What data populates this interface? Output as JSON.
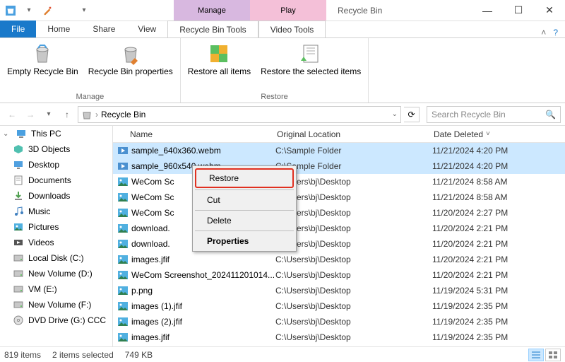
{
  "title": "Recycle Bin",
  "contextual_tabs": [
    {
      "group": "Manage",
      "tab": "Recycle Bin Tools"
    },
    {
      "group": "Play",
      "tab": "Video Tools"
    }
  ],
  "tabs": {
    "file": "File",
    "home": "Home",
    "share": "Share",
    "view": "View"
  },
  "ribbon": {
    "manage_group": "Manage",
    "restore_group": "Restore",
    "empty": "Empty Recycle Bin",
    "props": "Recycle Bin properties",
    "restore_all": "Restore all items",
    "restore_sel": "Restore the selected items"
  },
  "address": {
    "location": "Recycle Bin"
  },
  "search": {
    "placeholder": "Search Recycle Bin"
  },
  "nav_pane": [
    {
      "label": "This PC",
      "icon": "pc"
    },
    {
      "label": "3D Objects",
      "icon": "3d"
    },
    {
      "label": "Desktop",
      "icon": "desktop"
    },
    {
      "label": "Documents",
      "icon": "docs"
    },
    {
      "label": "Downloads",
      "icon": "downloads"
    },
    {
      "label": "Music",
      "icon": "music"
    },
    {
      "label": "Pictures",
      "icon": "pictures"
    },
    {
      "label": "Videos",
      "icon": "videos"
    },
    {
      "label": "Local Disk (C:)",
      "icon": "disk"
    },
    {
      "label": "New Volume (D:)",
      "icon": "disk"
    },
    {
      "label": "VM (E:)",
      "icon": "disk"
    },
    {
      "label": "New Volume (F:)",
      "icon": "disk"
    },
    {
      "label": "DVD Drive (G:) CCC",
      "icon": "dvd"
    }
  ],
  "columns": {
    "name": "Name",
    "loc": "Original Location",
    "date": "Date Deleted"
  },
  "rows": [
    {
      "name": "sample_640x360.webm",
      "loc": "C:\\Sample Folder",
      "date": "11/21/2024 4:20 PM",
      "icon": "video",
      "selected": true
    },
    {
      "name": "sample_960x540.webm",
      "loc": "C:\\Sample Folder",
      "date": "11/21/2024 4:20 PM",
      "icon": "video",
      "selected": true
    },
    {
      "name": "WeCom Sc",
      "loc": "C:\\Users\\bj\\Desktop",
      "date": "11/21/2024 8:58 AM",
      "icon": "img"
    },
    {
      "name": "WeCom Sc",
      "loc": "C:\\Users\\bj\\Desktop",
      "date": "11/21/2024 8:58 AM",
      "icon": "img"
    },
    {
      "name": "WeCom Sc",
      "loc": "C:\\Users\\bj\\Desktop",
      "date": "11/20/2024 2:27 PM",
      "icon": "img"
    },
    {
      "name": "download.",
      "loc": "C:\\Users\\bj\\Desktop",
      "date": "11/20/2024 2:21 PM",
      "icon": "img"
    },
    {
      "name": "download.",
      "loc": "C:\\Users\\bj\\Desktop",
      "date": "11/20/2024 2:21 PM",
      "icon": "img"
    },
    {
      "name": "images.jfif",
      "loc": "C:\\Users\\bj\\Desktop",
      "date": "11/20/2024 2:21 PM",
      "icon": "img"
    },
    {
      "name": "WeCom Screenshot_202411201014...",
      "loc": "C:\\Users\\bj\\Desktop",
      "date": "11/20/2024 2:21 PM",
      "icon": "img"
    },
    {
      "name": "p.png",
      "loc": "C:\\Users\\bj\\Desktop",
      "date": "11/19/2024 5:31 PM",
      "icon": "img"
    },
    {
      "name": "images (1).jfif",
      "loc": "C:\\Users\\bj\\Desktop",
      "date": "11/19/2024 2:35 PM",
      "icon": "img"
    },
    {
      "name": "images (2).jfif",
      "loc": "C:\\Users\\bj\\Desktop",
      "date": "11/19/2024 2:35 PM",
      "icon": "img"
    },
    {
      "name": "images.jfif",
      "loc": "C:\\Users\\bj\\Desktop",
      "date": "11/19/2024 2:35 PM",
      "icon": "img"
    }
  ],
  "context_menu": {
    "restore": "Restore",
    "cut": "Cut",
    "delete": "Delete",
    "properties": "Properties"
  },
  "status": {
    "items": "819 items",
    "selected": "2 items selected",
    "size": "749 KB"
  }
}
